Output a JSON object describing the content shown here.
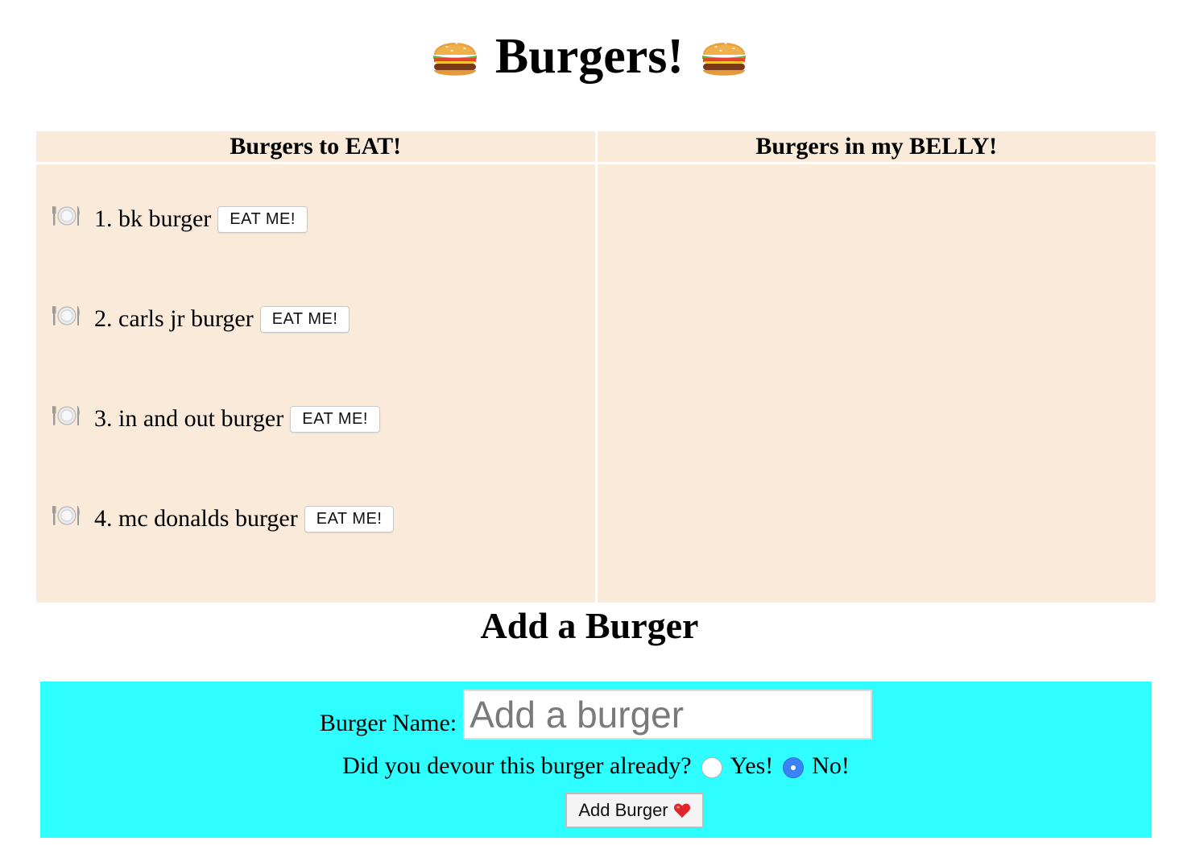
{
  "page": {
    "title": "Burgers!",
    "title_icon": "burger-icon"
  },
  "table": {
    "col_to_eat": "Burgers to EAT!",
    "col_eaten": "Burgers in my BELLY!",
    "to_eat": [
      {
        "text": "1. bk burger",
        "button": "EAT ME!"
      },
      {
        "text": "2. carls jr burger",
        "button": "EAT ME!"
      },
      {
        "text": "3. in and out burger",
        "button": "EAT ME!"
      },
      {
        "text": "4. mc donalds burger",
        "button": "EAT ME!"
      }
    ],
    "eaten": [],
    "item_icon": "plate-cutlery-icon",
    "bg_color": "#f9eada"
  },
  "add_form": {
    "heading": "Add a Burger",
    "name_label": "Burger Name:",
    "name_placeholder": "Add a burger",
    "devour_question": "Did you devour this burger already?",
    "option_yes": "Yes!",
    "option_no": "No!",
    "selected_option": "No!",
    "submit_label": "Add Burger",
    "submit_icon": "heart-icon",
    "panel_color": "#2efefe"
  }
}
